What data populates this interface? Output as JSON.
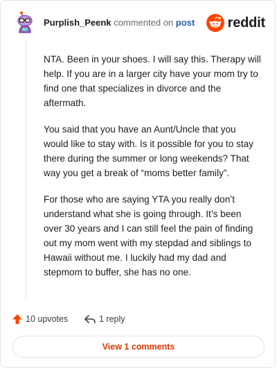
{
  "header": {
    "username": "Purplish_Peenk",
    "commented_text": "commented on",
    "post_link": "post",
    "brand_text": "reddit",
    "avatar_icon": "snoo-avatar-icon",
    "brand_icon": "reddit-alien-logo"
  },
  "comment": {
    "paragraphs": [
      "NTA. Been in your shoes. I will say this. Therapy will help. If you are in a larger city have your mom try to find one that specializes in divorce and the aftermath.",
      "You said that you have an Aunt/Uncle that you would like to stay with. Is it possible for you to stay there during the summer or long weekends? That way you get a break of “moms better family”.",
      "For those who are saying YTA you really don’t understand what she is going through. It’s been over 30 years and I can still feel the pain of finding out my mom went with my stepdad and siblings to Hawaii without me. I luckily had my dad and stepmom to buffer, she has no one."
    ]
  },
  "actions": {
    "upvotes_label": "10 upvotes",
    "reply_label": "1 reply",
    "upvote_icon": "upvote-arrow-icon",
    "reply_icon": "reply-arrow-icon"
  },
  "view_comments_label": "View 1 comments",
  "colors": {
    "accent": "#d93a00",
    "reddit_orange": "#ff4500",
    "link_blue": "#2c5ea8",
    "avatar_purple": "#9b59b6"
  }
}
